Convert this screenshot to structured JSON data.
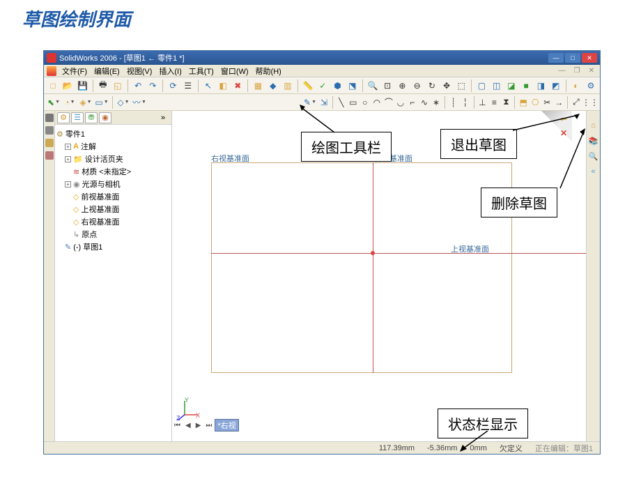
{
  "page_title": "草图绘制界面",
  "title": "SolidWorks 2006 - [草图1 ← 零件1 *]",
  "menu": {
    "file": "文件(F)",
    "edit": "编辑(E)",
    "view": "视图(V)",
    "insert": "插入(I)",
    "tool": "工具(T)",
    "window": "窗口(W)",
    "help": "帮助(H)"
  },
  "tree": {
    "root": "零件1",
    "anno": "注解",
    "folder": "设计活页夹",
    "material": "材质 <未指定>",
    "light": "光源与相机",
    "plane_front": "前视基准面",
    "plane_top": "上视基准面",
    "plane_right": "右视基准面",
    "origin": "原点",
    "sketch": "(-) 草图1"
  },
  "canvas": {
    "label_right": "右视基准面",
    "label_front": "前视基准面",
    "label_top": "上视基准面",
    "tab": "*右视"
  },
  "status": {
    "x": "117.39mm",
    "y": "-5.36mm",
    "z": "0mm",
    "def": "欠定义",
    "edit": "正在编辑：草图1"
  },
  "callouts": {
    "tools": "绘图工具栏",
    "exit": "退出草图",
    "delete": "删除草图",
    "status": "状态栏显示"
  }
}
